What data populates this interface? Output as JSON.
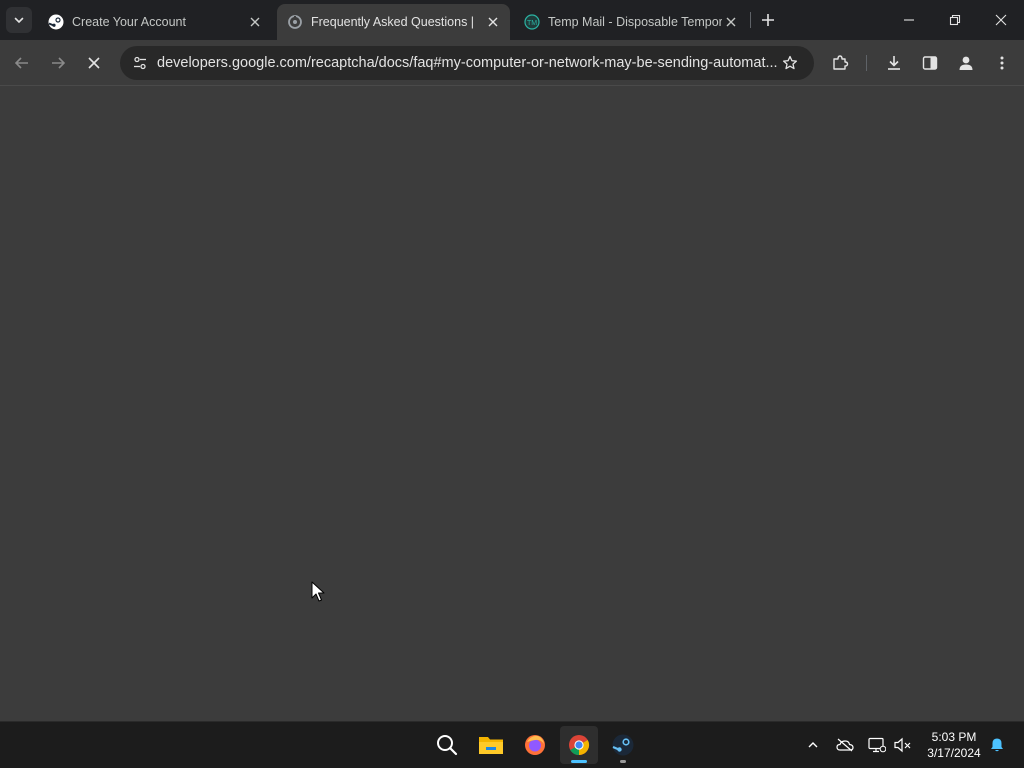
{
  "browser": {
    "tabs": [
      {
        "title": "Create Your Account",
        "favicon": "steam-icon",
        "active": false
      },
      {
        "title": "Frequently Asked Questions | ",
        "favicon": "recaptcha-icon",
        "active": true
      },
      {
        "title": "Temp Mail - Disposable Tempor",
        "favicon": "tempmail-icon",
        "active": false
      }
    ],
    "address_bar": {
      "url": "developers.google.com/recaptcha/docs/faq#my-computer-or-network-may-be-sending-automat..."
    },
    "page_state": "loading"
  },
  "taskbar": {
    "apps": [
      "search-icon",
      "file-explorer-icon",
      "firefox-icon",
      "chrome-icon",
      "steam-icon"
    ],
    "active_app": "chrome-icon",
    "tray": {
      "time": "5:03 PM",
      "date": "3/17/2024"
    }
  },
  "colors": {
    "tab_strip": "#202124",
    "toolbar": "#3c3c3c",
    "omnibox": "#282828",
    "content": "#3c3c3c",
    "taskbar": "#1c1c1c",
    "accent": "#4cc2ff"
  }
}
